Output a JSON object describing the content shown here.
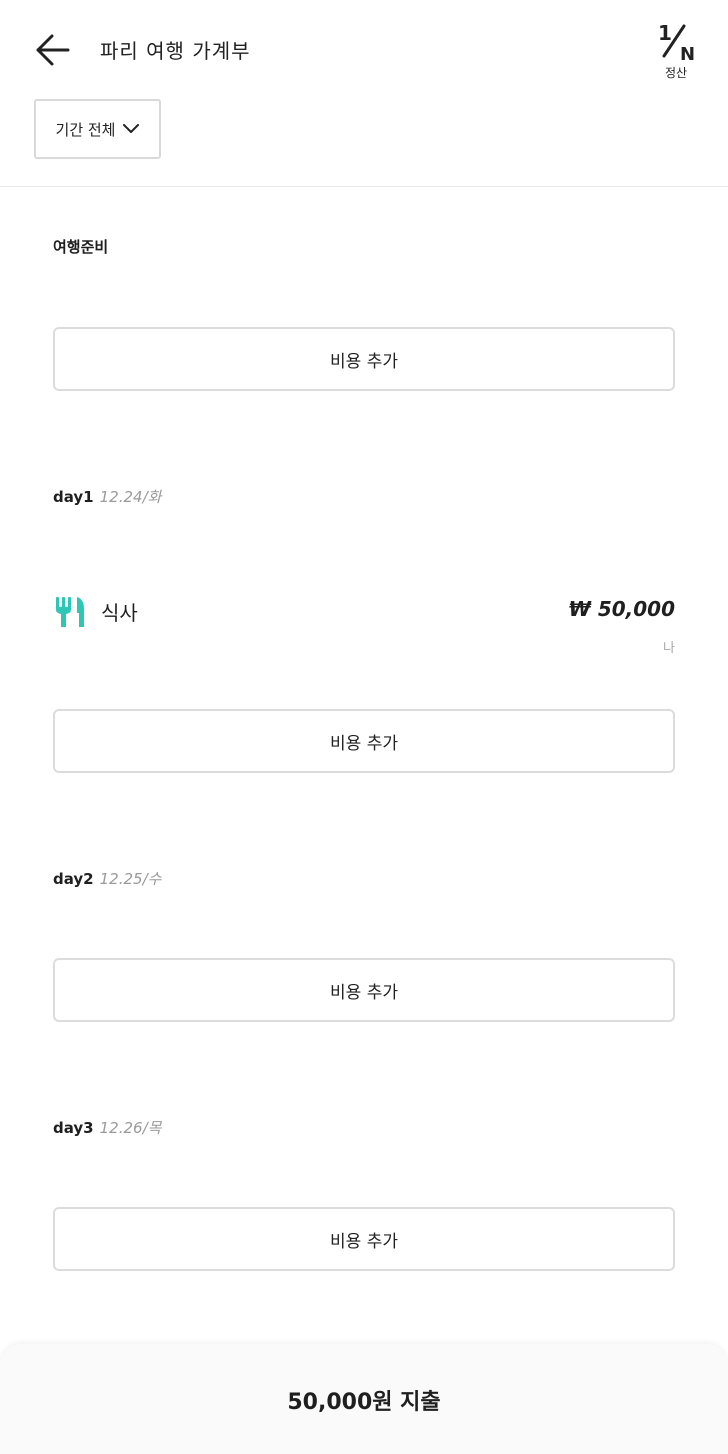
{
  "header": {
    "title": "파리 여행 가계부",
    "settle_label": "정산",
    "settle_fraction_top": "1",
    "settle_fraction_bottom": "N"
  },
  "filter": {
    "period_label": "기간 전체"
  },
  "sections": [
    {
      "title": "여행준비",
      "date": "",
      "add_label": "비용 추가"
    },
    {
      "title": "day1",
      "date": "12.24/화",
      "add_label": "비용 추가"
    },
    {
      "title": "day2",
      "date": "12.25/수",
      "add_label": "비용 추가"
    },
    {
      "title": "day3",
      "date": "12.26/목",
      "add_label": "비용 추가"
    }
  ],
  "expenses": [
    {
      "icon": "fork-knife-icon",
      "name": "식사",
      "amount": "₩ 50,000",
      "payer": "나",
      "icon_color": "#2ec7b6"
    }
  ],
  "footer": {
    "total_text": "50,000원 지출"
  }
}
